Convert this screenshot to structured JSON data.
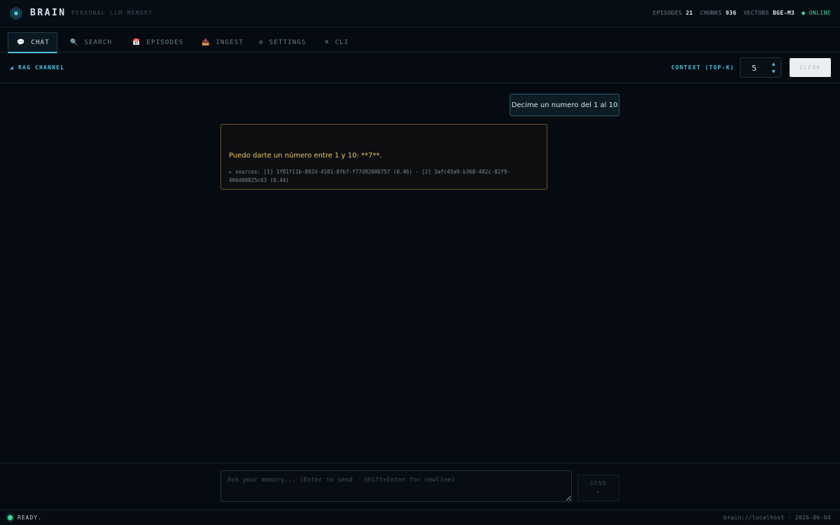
{
  "app": {
    "brand": "BRAIN",
    "tagline": "PERSONAL LLM MEMORY",
    "logo_icon": "brain-node-icon"
  },
  "stats": {
    "episodes_label": "EPISODES",
    "episodes_value": "21",
    "chunks_label": "CHUNKS",
    "chunks_value": "936",
    "vectors_label": "VECTORS",
    "vectors_value": "BGE-M3",
    "status": "● ONLINE",
    "status_color": "#3ddc97"
  },
  "tabs": [
    {
      "label": "CHAT",
      "icon": "💬",
      "icon_name": "chat-bubble-icon",
      "active": true
    },
    {
      "label": "SEARCH",
      "icon": "🔍",
      "icon_name": "search-icon",
      "active": false
    },
    {
      "label": "EPISODES",
      "icon": "📅",
      "icon_name": "calendar-icon",
      "active": false
    },
    {
      "label": "INGEST",
      "icon": "📥",
      "icon_name": "inbox-icon",
      "active": false
    },
    {
      "label": "SETTINGS",
      "icon": "⚙",
      "icon_name": "gear-icon",
      "active": false
    },
    {
      "label": "CLI",
      "icon": "⌘",
      "icon_name": "command-icon",
      "active": false
    }
  ],
  "channel": {
    "label": "◢ RAG CHANNEL",
    "context_label": "CONTEXT (TOP-K)",
    "context_value": "5",
    "clear_label": "CLEAR"
  },
  "messages": {
    "user": "Decime un numero del 1 al 10",
    "assistant": "Puedo darte un número entre 1 y 10: **7**.",
    "sources": "▸ sources: [1] 1f81f11b-892d-4181-8fb7-f77d92086757 (0.46)  ·  [2] 3afc45a9-b368-482c-82f9-466d00825c63 (0.44)"
  },
  "input": {
    "placeholder": "Ask your memory... (Enter to send · Shift+Enter for newline)",
    "value": "",
    "send_label": "SEND",
    "send_arrow": "▸"
  },
  "status": {
    "ready": "READY.",
    "host": "brain://localhost · 2026-06-04"
  },
  "colors": {
    "accent": "#4fc3e0",
    "assistant_text": "#f0c866",
    "assistant_border": "#6e5a22",
    "background": "#060b12"
  }
}
